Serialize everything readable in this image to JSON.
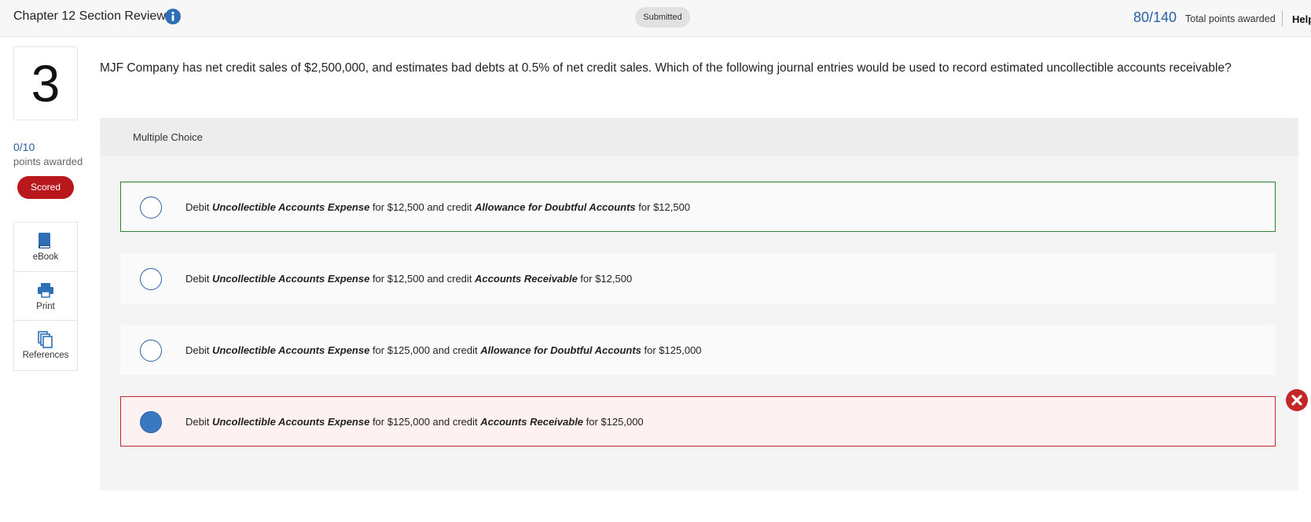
{
  "header": {
    "title": "Chapter 12 Section Review",
    "status": "Submitted",
    "total_points": "80/140",
    "total_points_label": "Total points awarded",
    "help": "Help"
  },
  "question": {
    "number": "3",
    "points": "0/10",
    "points_label": "points awarded",
    "scored_badge": "Scored",
    "text": "MJF Company has net credit sales of $2,500,000, and estimates bad debts at 0.5% of net credit sales. Which of the following journal entries would be used to record estimated uncollectible accounts receivable?",
    "type_label": "Multiple Choice"
  },
  "tools": [
    {
      "label": "eBook",
      "icon": "book-icon"
    },
    {
      "label": "Print",
      "icon": "printer-icon"
    },
    {
      "label": "References",
      "icon": "references-icon"
    }
  ],
  "choices": [
    {
      "pre": "Debit ",
      "acc1": "Uncollectible Accounts Expense",
      "mid": " for $12,500 and credit ",
      "acc2": "Allowance for Doubtful Accounts",
      "post": " for $12,500",
      "state": "correct",
      "selected": false
    },
    {
      "pre": "Debit ",
      "acc1": "Uncollectible Accounts Expense",
      "mid": " for $12,500 and credit ",
      "acc2": "Accounts Receivable",
      "post": " for $12,500",
      "state": "neutral",
      "selected": false
    },
    {
      "pre": "Debit ",
      "acc1": "Uncollectible Accounts Expense",
      "mid": " for $125,000 and credit ",
      "acc2": "Allowance for Doubtful Accounts",
      "post": " for $125,000",
      "state": "neutral",
      "selected": false
    },
    {
      "pre": "Debit ",
      "acc1": "Uncollectible Accounts Expense",
      "mid": " for $125,000 and credit ",
      "acc2": "Accounts Receivable",
      "post": " for $125,000",
      "state": "wrong",
      "selected": true
    }
  ],
  "colors": {
    "accent_blue": "#2b5fa4",
    "correct_border": "#2e7d32",
    "wrong_border": "#c4272a",
    "scored_red": "#b8181b"
  }
}
